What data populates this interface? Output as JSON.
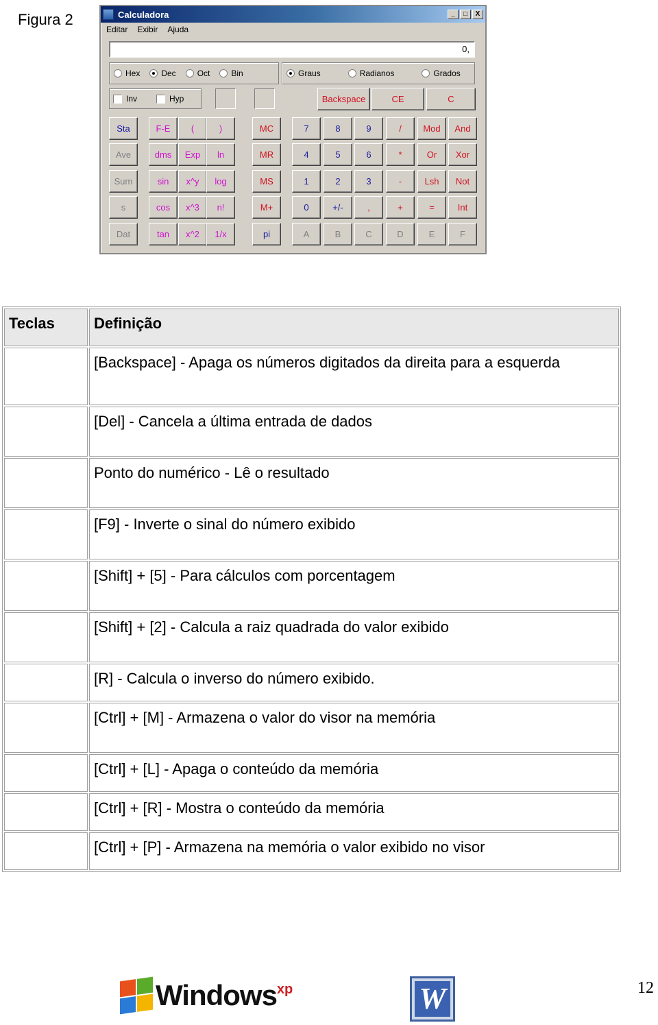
{
  "figure_label": "Figura 2",
  "calculator": {
    "title": "Calculadora",
    "window_buttons": [
      "_",
      "□",
      "X"
    ],
    "menu": [
      "Editar",
      "Exibir",
      "Ajuda"
    ],
    "display_value": "0,",
    "number_system": {
      "options": [
        "Hex",
        "Dec",
        "Oct",
        "Bin"
      ],
      "selected": "Dec"
    },
    "angle_mode": {
      "options": [
        "Graus",
        "Radianos",
        "Grados"
      ],
      "selected": "Graus"
    },
    "checkboxes": [
      {
        "label": "Inv",
        "checked": false
      },
      {
        "label": "Hyp",
        "checked": false
      }
    ],
    "top_buttons": [
      "Backspace",
      "CE",
      "C"
    ],
    "stat_column": [
      "Sta",
      "Ave",
      "Sum",
      "s",
      "Dat"
    ],
    "sci_rows": [
      [
        "F-E",
        "(",
        ")"
      ],
      [
        "dms",
        "Exp",
        "ln"
      ],
      [
        "sin",
        "x^y",
        "log"
      ],
      [
        "cos",
        "x^3",
        "n!"
      ],
      [
        "tan",
        "x^2",
        "1/x"
      ]
    ],
    "memory_column": [
      "MC",
      "MR",
      "MS",
      "M+",
      "pi"
    ],
    "main_rows": [
      [
        "7",
        "8",
        "9",
        "/",
        "Mod",
        "And"
      ],
      [
        "4",
        "5",
        "6",
        "*",
        "Or",
        "Xor"
      ],
      [
        "1",
        "2",
        "3",
        "-",
        "Lsh",
        "Not"
      ],
      [
        "0",
        "+/-",
        ",",
        "+",
        "=",
        "Int"
      ],
      [
        "A",
        "B",
        "C",
        "D",
        "E",
        "F"
      ]
    ]
  },
  "table": {
    "headers": [
      "Teclas",
      "Definição"
    ],
    "rows": [
      {
        "key": "",
        "definition": "[Backspace] - Apaga os números digitados da direita para a esquerda"
      },
      {
        "key": "",
        "definition": "[Del] - Cancela a última entrada de dados"
      },
      {
        "key": "",
        "definition": "Ponto do numérico - Lê o resultado"
      },
      {
        "key": "",
        "definition": "[F9] - Inverte o sinal do número exibido"
      },
      {
        "key": "",
        "definition": "[Shift] + [5] - Para cálculos com porcentagem"
      },
      {
        "key": "",
        "definition": "[Shift] + [2] - Calcula a raiz quadrada do valor exibido"
      },
      {
        "key": "",
        "definition": "[R] - Calcula o inverso do número exibido."
      },
      {
        "key": "",
        "definition": "[Ctrl] + [M] - Armazena o valor do visor na memória"
      },
      {
        "key": "",
        "definition": "[Ctrl] + [L] - Apaga o conteúdo da memória"
      },
      {
        "key": "",
        "definition": "[Ctrl] + [R] - Mostra o conteúdo da memória"
      },
      {
        "key": "",
        "definition": "[Ctrl] + [P] - Armazena na memória o valor exibido no visor"
      }
    ]
  },
  "footer": {
    "windows_logo_text": "Windows",
    "windows_logo_suffix": "xp",
    "word_icon_letter": "W",
    "page_number": "12"
  }
}
